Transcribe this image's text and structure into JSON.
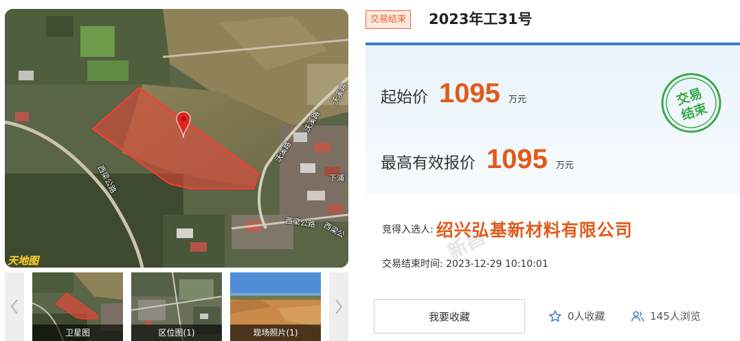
{
  "gallery": {
    "map_labels": {
      "road_woxi_1": "沃溪路",
      "road_woxi_2": "沃溪路",
      "road_woxi_3": "沃溪路",
      "road_xiliang_1": "西梁公路",
      "road_xiliang_2": "西梁公路",
      "road_xiliang_3": "西梁公",
      "village_xiapu": "下浦"
    },
    "watermark": "天地图",
    "thumbnails": [
      {
        "caption": "卫星图"
      },
      {
        "caption": "区位图(1)"
      },
      {
        "caption": "现场照片(1)"
      }
    ]
  },
  "header": {
    "status_tag": "交易结束",
    "title": "2023年工31号"
  },
  "prices": {
    "start": {
      "label": "起始价",
      "value": "1095",
      "unit": "万元"
    },
    "highest": {
      "label": "最高有效报价",
      "value": "1095",
      "unit": "万元"
    }
  },
  "stamp": {
    "line1": "交易",
    "line2": "结束"
  },
  "winner": {
    "label": "竞得入选人:",
    "name": "绍兴弘基新材料有限公司"
  },
  "end_time": {
    "label": "交易结束时间:",
    "value": "2023-12-29 10:10:01"
  },
  "site_watermark": "新昌",
  "actions": {
    "favorite_label": "我要收藏",
    "favorites_count": "0人收藏",
    "views_count": "145人浏览"
  },
  "colors": {
    "accent_orange": "#e25a19",
    "panel_border_blue": "#3a78d6",
    "stamp_green": "#3aa846"
  }
}
